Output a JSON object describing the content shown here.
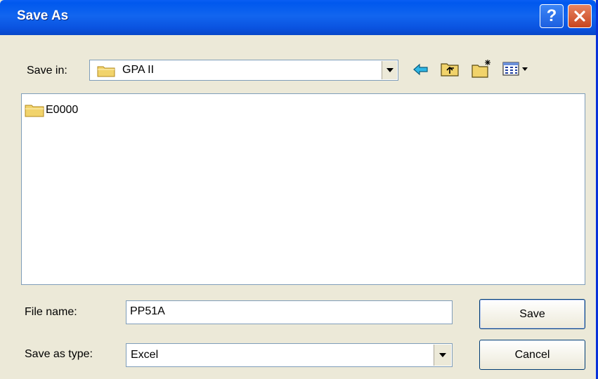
{
  "window": {
    "title": "Save As",
    "help_label": "?",
    "close_icon": "close-icon"
  },
  "toolbar": {
    "save_in_label": "Save in:",
    "current_folder": "GPA II",
    "icons": [
      "back-arrow-icon",
      "up-folder-icon",
      "new-folder-icon",
      "view-menu-icon"
    ],
    "colors": {
      "back_arrow": "#2fb7e6",
      "folder": "#f1d36b"
    }
  },
  "file_list": {
    "items": [
      {
        "name": "E0000",
        "icon": "folder-icon"
      }
    ]
  },
  "form": {
    "file_name_label": "File name:",
    "file_name_value": "PP51A",
    "save_as_type_label": "Save as type:",
    "save_as_type_value": "Excel"
  },
  "buttons": {
    "save_label": "Save",
    "cancel_label": "Cancel"
  }
}
